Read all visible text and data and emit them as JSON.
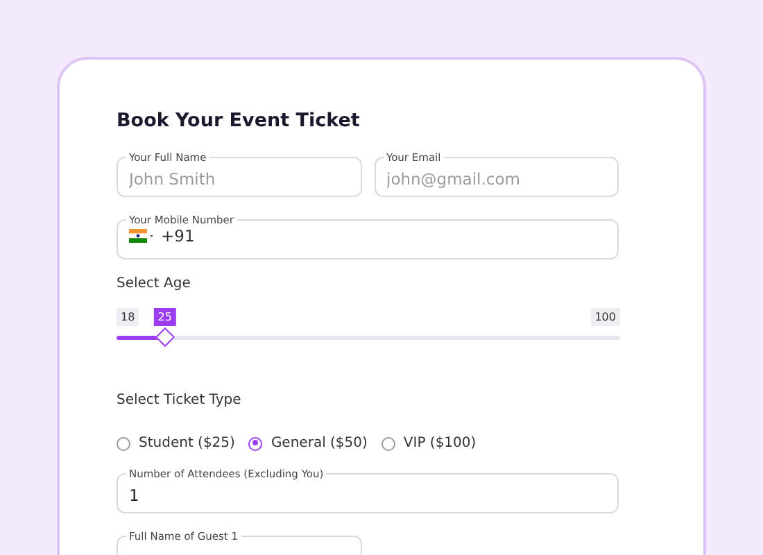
{
  "form": {
    "title": "Book Your Event Ticket",
    "name_field": {
      "label": "Your Full Name",
      "placeholder": "John Smith"
    },
    "email_field": {
      "label": "Your Email",
      "placeholder": "john@gmail.com"
    },
    "phone_field": {
      "label": "Your Mobile Number",
      "value": "+91"
    },
    "age": {
      "label": "Select Age",
      "min": "18",
      "value": "25",
      "max": "100",
      "level": 0.096
    },
    "ticket_type": {
      "label": "Select Ticket Type",
      "options": [
        {
          "label": "Student ($25)",
          "selected": false
        },
        {
          "label": "General ($50)",
          "selected": true
        },
        {
          "label": "VIP ($100)",
          "selected": false
        }
      ]
    },
    "attendees_field": {
      "label": "Number of Attendees (Excluding You)",
      "value": "1"
    },
    "guest_fields": [
      {
        "label": "Full Name of Guest 1"
      }
    ]
  }
}
